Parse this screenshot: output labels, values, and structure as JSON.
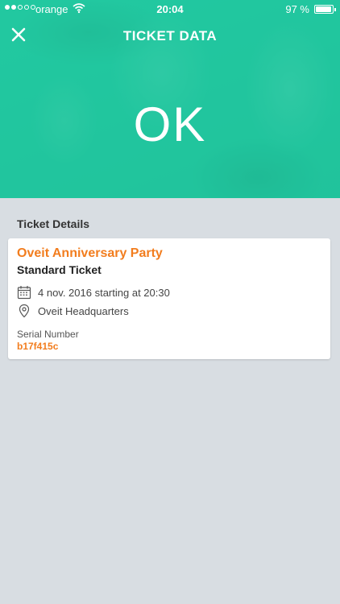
{
  "status_bar": {
    "carrier": "orange",
    "time": "20:04",
    "battery_percent": "97 %",
    "battery_level": 0.97,
    "signal_bars_filled": 2,
    "signal_bars_total": 5
  },
  "header": {
    "title": "TICKET DATA",
    "status_text": "OK",
    "background_color": "#22c9a1"
  },
  "section": {
    "title": "Ticket Details"
  },
  "ticket": {
    "event_name": "Oveit Anniversary Party",
    "ticket_type": "Standard Ticket",
    "date": "4 nov. 2016 starting at 20:30",
    "location": "Oveit Headquarters",
    "serial_label": "Serial Number",
    "serial_value": "b17f415c"
  },
  "colors": {
    "accent": "#f27d1e",
    "page_background": "#d8dde2"
  }
}
